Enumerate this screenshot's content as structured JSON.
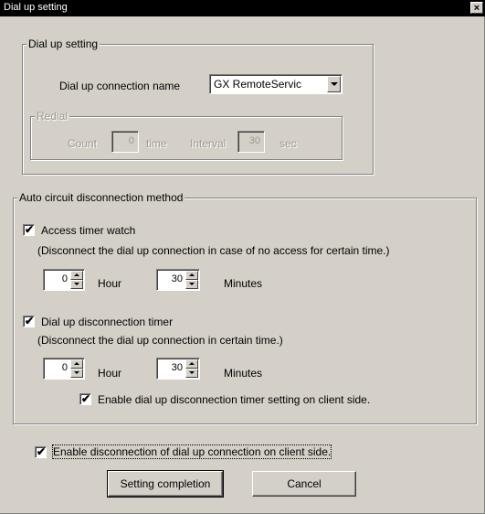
{
  "window": {
    "title": "Dial up setting",
    "close_glyph": "×"
  },
  "dialup_group": {
    "label": "Dial up setting",
    "connection_name_label": "Dial up connection name",
    "connection_name_value": "GX RemoteServic",
    "redial": {
      "label": "Redial",
      "count_label": "Count",
      "count_value": "0",
      "time_unit": "time",
      "interval_label": "Interval",
      "interval_value": "30",
      "sec_unit": "sec"
    }
  },
  "auto_group": {
    "label": "Auto circuit disconnection method",
    "access_timer": {
      "checked": true,
      "label": "Access timer watch",
      "description": "(Disconnect the dial up connection in case of no access for certain time.)",
      "hour_value": "0",
      "hour_label": "Hour",
      "minutes_value": "30",
      "minutes_label": "Minutes"
    },
    "disconnection_timer": {
      "checked": true,
      "label": "Dial up disconnection timer",
      "description": "(Disconnect the dial up connection in certain time.)",
      "hour_value": "0",
      "hour_label": "Hour",
      "minutes_value": "30",
      "minutes_label": "Minutes",
      "client_side_checked": true,
      "client_side_label": "Enable dial up disconnection timer setting on client side."
    }
  },
  "client_disconnect": {
    "checked": true,
    "label": "Enable disconnection of dial up connection on client side."
  },
  "buttons": {
    "setting_completion": "Setting completion",
    "cancel": "Cancel"
  },
  "check_glyph": "✔"
}
